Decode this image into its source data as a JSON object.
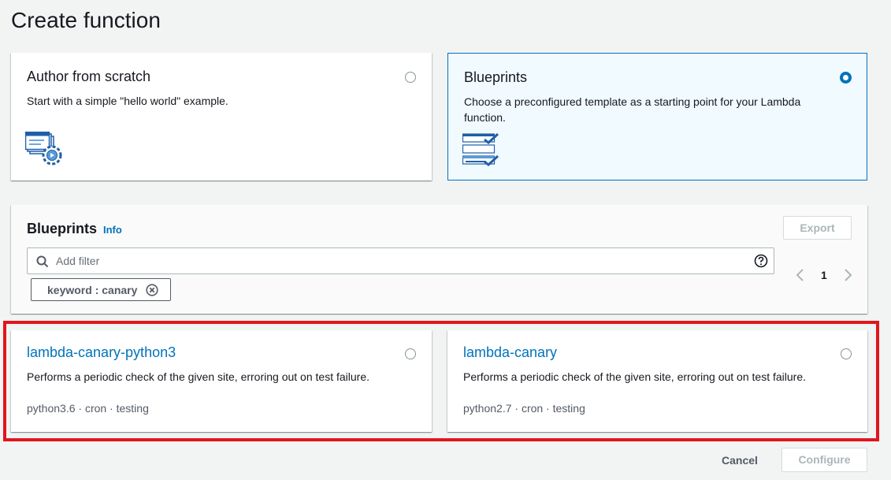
{
  "page": {
    "title": "Create function"
  },
  "options": {
    "scratch": {
      "title": "Author from scratch",
      "description": "Start with a simple \"hello world\" example.",
      "icon": "code-gear-icon",
      "selected": false
    },
    "blueprints": {
      "title": "Blueprints",
      "description": "Choose a preconfigured template as a starting point for your Lambda function.",
      "icon": "checklist-icon",
      "selected": true
    }
  },
  "blueprints_panel": {
    "title": "Blueprints",
    "info_label": "Info",
    "export_label": "Export",
    "filter": {
      "placeholder": "Add filter",
      "value": ""
    },
    "token_label": "keyword : canary",
    "pagination": {
      "current_page": "1"
    }
  },
  "results": [
    {
      "title": "lambda-canary-python3",
      "description": "Performs a periodic check of the given site, erroring out on test failure.",
      "meta": "python3.6 · cron · testing"
    },
    {
      "title": "lambda-canary",
      "description": "Performs a periodic check of the given site, erroring out on test failure.",
      "meta": "python2.7 · cron · testing"
    }
  ],
  "footer": {
    "cancel_label": "Cancel",
    "configure_label": "Configure"
  },
  "colors": {
    "accent": "#0073bb",
    "highlight": "#e0161c",
    "disabled_text": "#aab7b8"
  }
}
